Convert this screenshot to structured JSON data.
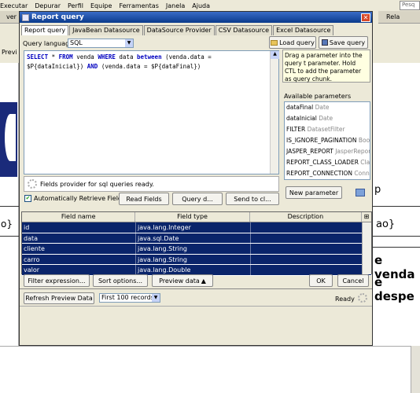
{
  "menubar": {
    "items": [
      "Executar",
      "Depurar",
      "Perfil",
      "Equipe",
      "Ferramentas",
      "Janela",
      "Ajuda"
    ],
    "search_placeholder": "Pesq"
  },
  "background": {
    "tab_left": "ver",
    "tab_right": "Rela",
    "preview_text": "Previ",
    "left_fragment_a": "o}",
    "right_fragment_p": "p",
    "right_fragment_ao": "ao}",
    "right_line1": "e venda",
    "right_line2": "e despe"
  },
  "dialog": {
    "title": "Report query",
    "tabs": [
      "Report query",
      "JavaBean Datasource",
      "DataSource Provider",
      "CSV Datasource",
      "Excel Datasource"
    ],
    "query_language_label": "Query language",
    "query_language_value": "SQL",
    "load_query": "Load query",
    "save_query": "Save query",
    "query_line1_kw1": "SELECT",
    "query_line1_a": " * ",
    "query_line1_kw2": "FROM",
    "query_line1_b": " venda ",
    "query_line1_kw3": "WHERE",
    "query_line1_c": " data ",
    "query_line1_kw4": "between",
    "query_line1_d": " (venda.data =",
    "query_line2_a": "$P{dataInicial}) ",
    "query_line2_kw": "AND",
    "query_line2_b": " (venda.data = $P{dataFinal})",
    "hint": "Drag a parameter into the query t parameter. Hold CTL to add the parameter as query chunk.",
    "available_parameters_label": "Available parameters",
    "parameters": [
      {
        "name": "dataFinal",
        "type": "Date"
      },
      {
        "name": "dataInicial",
        "type": "Date"
      },
      {
        "name": "FILTER",
        "type": "DatasetFilter"
      },
      {
        "name": "IS_IGNORE_PAGINATION",
        "type": "Boo"
      },
      {
        "name": "JASPER_REPORT",
        "type": "JasperRepor"
      },
      {
        "name": "REPORT_CLASS_LOADER",
        "type": "Clas"
      },
      {
        "name": "REPORT_CONNECTION",
        "type": "Conne"
      }
    ],
    "new_parameter": "New parameter",
    "provider_status": "Fields provider for sql queries ready.",
    "auto_retrieve_label": "Automatically Retrieve Fields",
    "read_fields": "Read Fields",
    "query_designer": "Query d...",
    "send_to": "Send to cl...",
    "fields": {
      "headers": [
        "Field name",
        "Field type",
        "Description"
      ],
      "rows": [
        [
          "id",
          "java.lang.Integer",
          ""
        ],
        [
          "data",
          "java.sql.Date",
          ""
        ],
        [
          "cliente",
          "java.lang.String",
          ""
        ],
        [
          "carro",
          "java.lang.String",
          ""
        ],
        [
          "valor",
          "java.lang.Double",
          ""
        ]
      ]
    },
    "filter_expression": "Filter expression...",
    "sort_options": "Sort options...",
    "preview_data": "Preview data",
    "ok": "OK",
    "cancel": "Cancel",
    "refresh_preview": "Refresh Preview Data",
    "records_select": "First 100 records",
    "ready": "Ready"
  }
}
